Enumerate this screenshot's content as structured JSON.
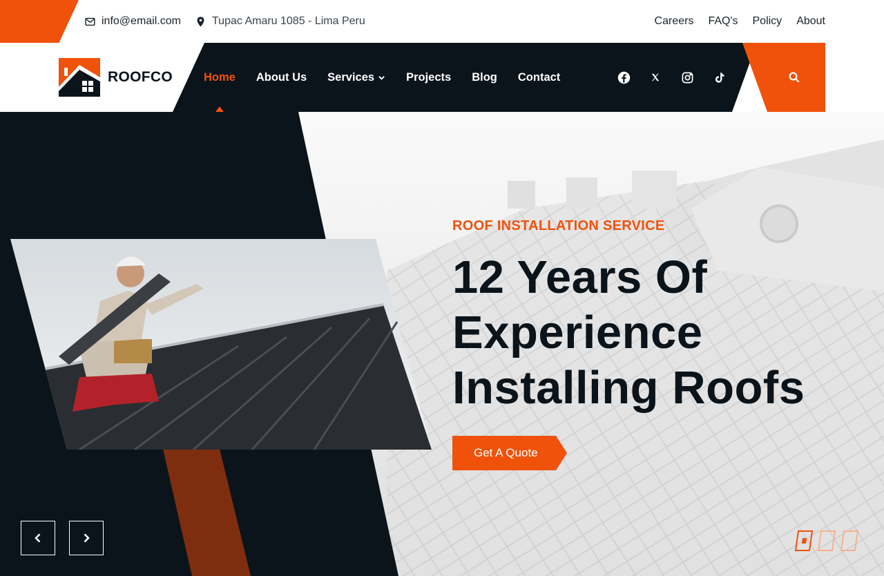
{
  "topbar": {
    "email": "info@email.com",
    "address": "Tupac Amaru 1085 - Lima Peru",
    "links": [
      "Careers",
      "FAQ's",
      "Policy",
      "About"
    ]
  },
  "brand": {
    "name": "ROOFCO"
  },
  "nav": {
    "items": [
      {
        "label": "Home",
        "active": true
      },
      {
        "label": "About Us"
      },
      {
        "label": "Services",
        "has_dropdown": true
      },
      {
        "label": "Projects"
      },
      {
        "label": "Blog"
      },
      {
        "label": "Contact"
      }
    ]
  },
  "socials": [
    "facebook-icon",
    "x-icon",
    "instagram-icon",
    "tiktok-icon"
  ],
  "hero": {
    "eyebrow": "ROOF INSTALLATION SERVICE",
    "headline": [
      "12 Years Of",
      "Experience",
      "Installing Roofs"
    ],
    "cta": "Get A Quote",
    "slides": 3,
    "active_slide": 1
  },
  "colors": {
    "accent": "#f0520b",
    "dark": "#0b141b",
    "stripe": "#7e2e0f"
  }
}
